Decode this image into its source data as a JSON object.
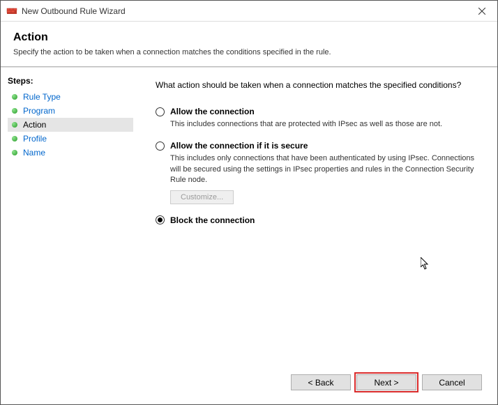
{
  "titlebar": {
    "title": "New Outbound Rule Wizard"
  },
  "header": {
    "title": "Action",
    "desc": "Specify the action to be taken when a connection matches the conditions specified in the rule."
  },
  "sidebar": {
    "heading": "Steps:",
    "items": [
      {
        "label": "Rule Type",
        "state": "done"
      },
      {
        "label": "Program",
        "state": "done"
      },
      {
        "label": "Action",
        "state": "active"
      },
      {
        "label": "Profile",
        "state": "future"
      },
      {
        "label": "Name",
        "state": "future"
      }
    ]
  },
  "main": {
    "question": "What action should be taken when a connection matches the specified conditions?",
    "option1": {
      "label": "Allow the connection",
      "desc": "This includes connections that are protected with IPsec as well as those are not."
    },
    "option2": {
      "label": "Allow the connection if it is secure",
      "desc": "This includes only connections that have been authenticated by using IPsec.  Connections will be secured using the settings in IPsec properties and rules in the Connection Security Rule node.",
      "customize": "Customize..."
    },
    "option3": {
      "label": "Block the connection"
    },
    "selected": "option3"
  },
  "buttons": {
    "back": "< Back",
    "next": "Next >",
    "cancel": "Cancel"
  }
}
